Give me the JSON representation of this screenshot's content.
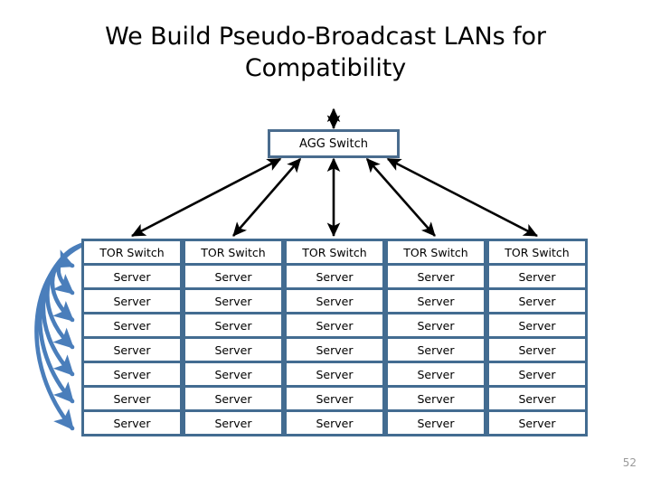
{
  "slide": {
    "title": "We Build Pseudo-Broadcast LANs for Compatibility",
    "number": "52",
    "background_color": "#ffffff",
    "title_color": "#000000",
    "slide_number_color": "#9a9a9a"
  },
  "colors": {
    "box_border": "#436C91",
    "agg_box_border": "#4A6C8E",
    "black_arrow": "#000000",
    "blue_arrow": "#4A7EBB"
  },
  "diagram": {
    "agg_switch": {
      "label": "AGG Switch"
    },
    "uplink_arrow": {
      "name": "agg-uplink-double-arrow",
      "direction": "bidirectional"
    },
    "agg_to_tor_links": [
      {
        "direction": "bidirectional",
        "target_column": 1
      },
      {
        "direction": "bidirectional",
        "target_column": 2
      },
      {
        "direction": "bidirectional",
        "target_column": 3
      },
      {
        "direction": "bidirectional",
        "target_column": 4
      },
      {
        "direction": "bidirectional",
        "target_column": 5
      }
    ],
    "columns": [
      {
        "tor_label": "TOR Switch",
        "servers": [
          "Server",
          "Server",
          "Server",
          "Server",
          "Server",
          "Server",
          "Server"
        ]
      },
      {
        "tor_label": "TOR Switch",
        "servers": [
          "Server",
          "Server",
          "Server",
          "Server",
          "Server",
          "Server",
          "Server"
        ]
      },
      {
        "tor_label": "TOR Switch",
        "servers": [
          "Server",
          "Server",
          "Server",
          "Server",
          "Server",
          "Server",
          "Server"
        ]
      },
      {
        "tor_label": "TOR Switch",
        "servers": [
          "Server",
          "Server",
          "Server",
          "Server",
          "Server",
          "Server",
          "Server"
        ]
      },
      {
        "tor_label": "TOR Switch",
        "servers": [
          "Server",
          "Server",
          "Server",
          "Server",
          "Server",
          "Server",
          "Server"
        ]
      }
    ],
    "pseudo_broadcast_arcs": {
      "name": "tor-to-server-broadcast-arcs",
      "count": 7,
      "color": "#4A7EBB",
      "origin": "column-1 TOR Switch left edge",
      "targets": "column-1 server rows 1-7 left edge"
    }
  }
}
